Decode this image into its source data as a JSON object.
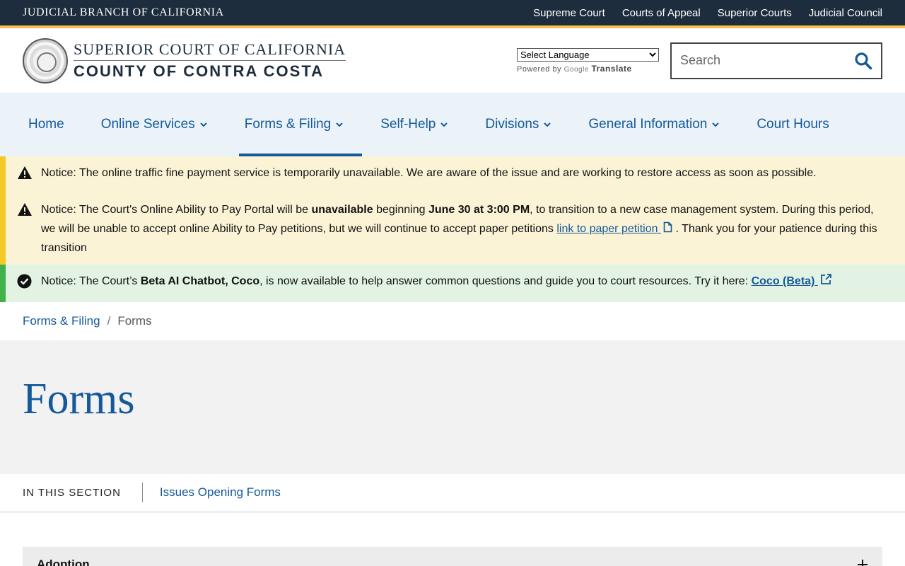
{
  "topbar": {
    "brand": "JUDICIAL BRANCH OF CALIFORNIA",
    "links": [
      "Supreme Court",
      "Courts of Appeal",
      "Superior Courts",
      "Judicial Council"
    ]
  },
  "header": {
    "line1": "SUPERIOR COURT OF CALIFORNIA",
    "line2": "COUNTY OF CONTRA COSTA",
    "language_select": "Select Language",
    "powered_by": "Powered by",
    "google": "Google",
    "translate": "Translate",
    "search_placeholder": "Search"
  },
  "nav": {
    "items": [
      {
        "label": "Home",
        "dropdown": false
      },
      {
        "label": "Online Services",
        "dropdown": true
      },
      {
        "label": "Forms & Filing",
        "dropdown": true,
        "active": true
      },
      {
        "label": "Self-Help",
        "dropdown": true
      },
      {
        "label": "Divisions",
        "dropdown": true
      },
      {
        "label": "General Information",
        "dropdown": true
      },
      {
        "label": "Court Hours",
        "dropdown": false
      }
    ]
  },
  "notices": {
    "n1": {
      "prefix": "Notice:",
      "text": "The online traffic fine payment service is temporarily unavailable. We are aware of the issue and are working to restore access as soon as possible."
    },
    "n2": {
      "prefix": "Notice:",
      "part1": "The Court's Online Ability to Pay Portal will be",
      "bold1": "unavailable",
      "part2": "beginning",
      "bold2": "June 30 at 3:00 PM",
      "part3": ", to transition to a new case management system. During this period, we will be unable to accept online Ability to Pay petitions, but we will continue to accept paper petitions",
      "link": "link to paper petition",
      "part4": ". Thank you for your patience during this transition"
    },
    "n3": {
      "prefix": "Notice:",
      "part1": "The Court’s",
      "bold1": "Beta AI Chatbot, Coco",
      "part2": ", is now available to help answer common questions and guide you to court resources. Try it here:",
      "link": "Coco (Beta)"
    }
  },
  "breadcrumb": {
    "parent": "Forms & Filing",
    "separator": "/",
    "current": "Forms"
  },
  "hero": {
    "title": "Forms"
  },
  "in_section": {
    "label": "IN THIS SECTION",
    "link": "Issues Opening Forms"
  },
  "accordion": {
    "first_title": "Adoption"
  },
  "colors": {
    "topbar_bg": "#1d2d3d",
    "accent_gold": "#f2c14e",
    "link_blue": "#15599a",
    "nav_bg": "#ebf3f9",
    "warning_bg": "#fbf3d6",
    "success_bg": "#e3f3e3"
  }
}
